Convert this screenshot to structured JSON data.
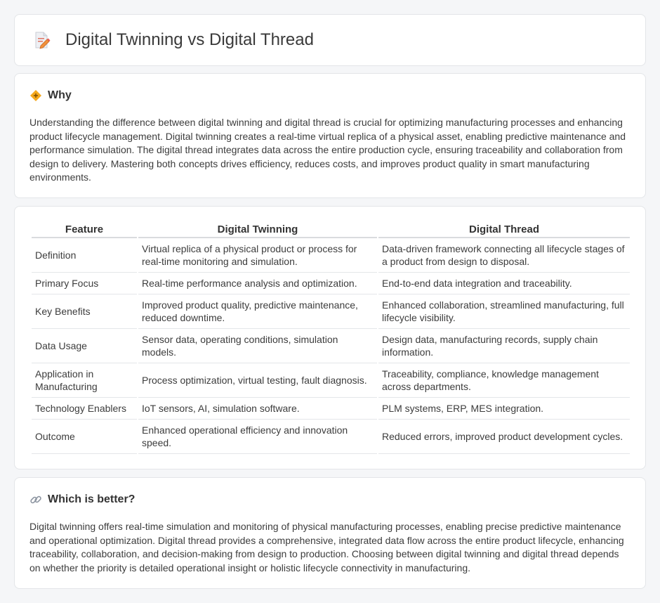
{
  "header": {
    "title": "Digital Twinning vs Digital Thread",
    "icon": "document-edit-icon"
  },
  "why": {
    "title": "Why",
    "icon": "diamond-warning-icon",
    "text": "Understanding the difference between digital twinning and digital thread is crucial for optimizing manufacturing processes and enhancing product lifecycle management. Digital twinning creates a real-time virtual replica of a physical asset, enabling predictive maintenance and performance simulation. The digital thread integrates data across the entire production cycle, ensuring traceability and collaboration from design to delivery. Mastering both concepts drives efficiency, reduces costs, and improves product quality in smart manufacturing environments."
  },
  "comparison": {
    "headers": [
      "Feature",
      "Digital Twinning",
      "Digital Thread"
    ],
    "rows": [
      [
        "Definition",
        "Virtual replica of a physical product or process for real-time monitoring and simulation.",
        "Data-driven framework connecting all lifecycle stages of a product from design to disposal."
      ],
      [
        "Primary Focus",
        "Real-time performance analysis and optimization.",
        "End-to-end data integration and traceability."
      ],
      [
        "Key Benefits",
        "Improved product quality, predictive maintenance, reduced downtime.",
        "Enhanced collaboration, streamlined manufacturing, full lifecycle visibility."
      ],
      [
        "Data Usage",
        "Sensor data, operating conditions, simulation models.",
        "Design data, manufacturing records, supply chain information."
      ],
      [
        "Application in Manufacturing",
        "Process optimization, virtual testing, fault diagnosis.",
        "Traceability, compliance, knowledge management across departments."
      ],
      [
        "Technology Enablers",
        "IoT sensors, AI, simulation software.",
        "PLM systems, ERP, MES integration."
      ],
      [
        "Outcome",
        "Enhanced operational efficiency and innovation speed.",
        "Reduced errors, improved product development cycles."
      ]
    ]
  },
  "better": {
    "title": "Which is better?",
    "icon": "link-icon",
    "text": "Digital twinning offers real-time simulation and monitoring of physical manufacturing processes, enabling precise predictive maintenance and operational optimization. Digital thread provides a comprehensive, integrated data flow across the entire product lifecycle, enhancing traceability, collaboration, and decision-making from design to production. Choosing between digital twinning and digital thread depends on whether the priority is detailed operational insight or holistic lifecycle connectivity in manufacturing."
  },
  "colors": {
    "background": "#f5f6f8",
    "card": "#ffffff",
    "border": "#e3e5e8",
    "text": "#3c3c3c"
  }
}
